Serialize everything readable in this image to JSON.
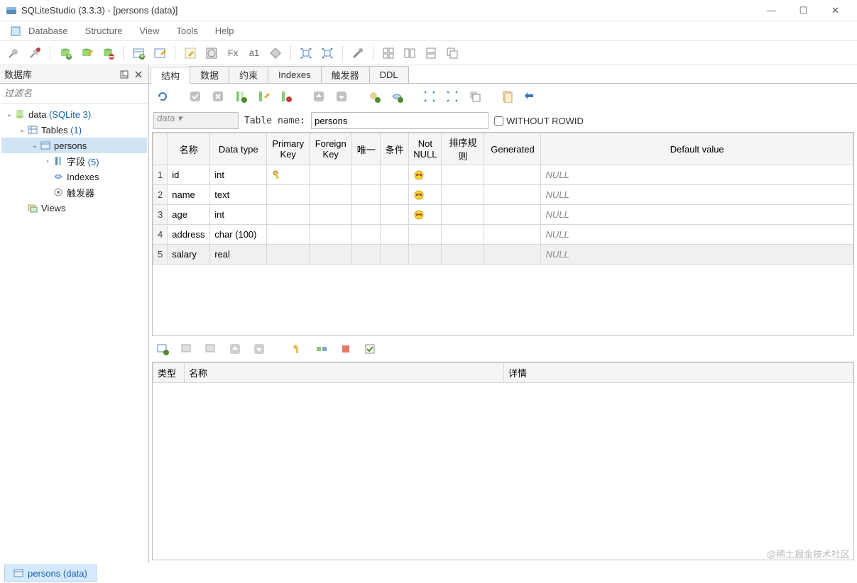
{
  "window": {
    "title": "SQLiteStudio (3.3.3) - [persons (data)]",
    "min": "—",
    "max": "☐",
    "close": "✕"
  },
  "menus": [
    "Database",
    "Structure",
    "View",
    "Tools",
    "Help"
  ],
  "sidebar": {
    "title": "数据库",
    "filter_placeholder": "过滤名",
    "tree": {
      "db_name": "data",
      "db_type": "(SQLite 3)",
      "tables_label": "Tables",
      "tables_count": "(1)",
      "table_name": "persons",
      "fields_label": "字段",
      "fields_count": "(5)",
      "indexes_label": "Indexes",
      "triggers_label": "触发器",
      "views_label": "Views"
    }
  },
  "tabs": [
    "结构",
    "数据",
    "约束",
    "Indexes",
    "触发器",
    "DDL"
  ],
  "name_row": {
    "db_combo": "data",
    "table_label": "Table name:",
    "table_value": "persons",
    "without_rowid": "WITHOUT ROWID"
  },
  "columns": {
    "headers": [
      "名称",
      "Data type",
      "Primary Key",
      "Foreign Key",
      "唯一",
      "条件",
      "Not NULL",
      "排序规则",
      "Generated",
      "Default value"
    ],
    "rows": [
      {
        "n": "1",
        "name": "id",
        "type": "int",
        "pk": true,
        "nn": true,
        "def": "NULL"
      },
      {
        "n": "2",
        "name": "name",
        "type": "text",
        "pk": false,
        "nn": true,
        "def": "NULL"
      },
      {
        "n": "3",
        "name": "age",
        "type": "int",
        "pk": false,
        "nn": true,
        "def": "NULL"
      },
      {
        "n": "4",
        "name": "address",
        "type": "char (100)",
        "pk": false,
        "nn": false,
        "def": "NULL"
      },
      {
        "n": "5",
        "name": "salary",
        "type": "real",
        "pk": false,
        "nn": false,
        "def": "NULL",
        "sel": true
      }
    ]
  },
  "details": {
    "headers": [
      "类型",
      "名称",
      "详情"
    ]
  },
  "dock": {
    "label": "persons (data)"
  },
  "watermark": "@稀土掘金技术社区"
}
